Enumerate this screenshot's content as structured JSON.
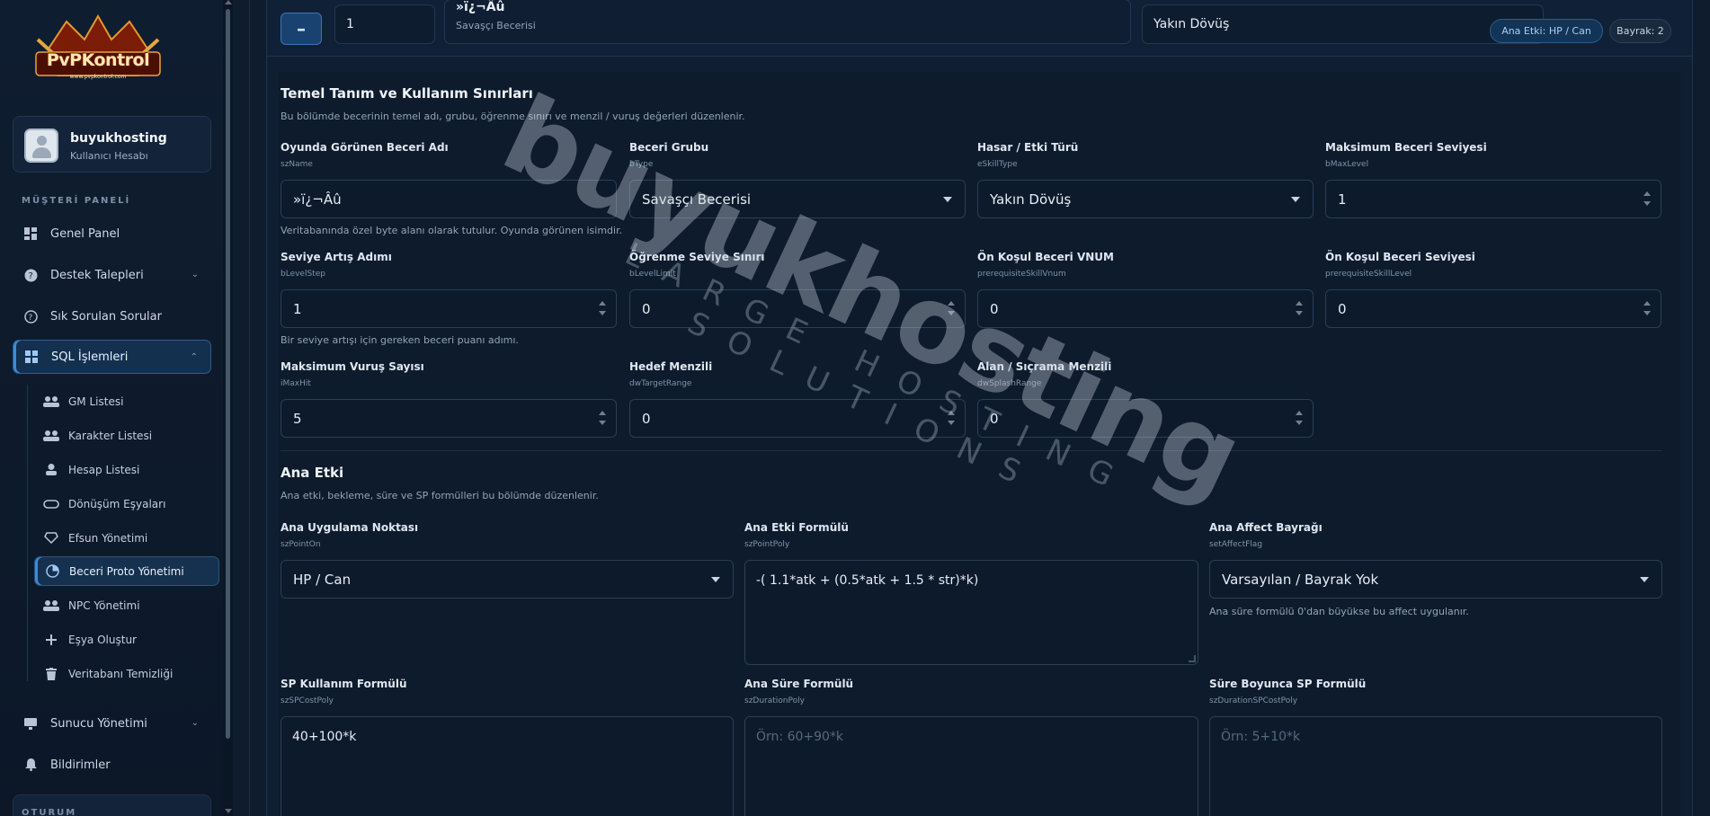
{
  "sidebar": {
    "logo": {
      "text": "PvPKontrol",
      "sub": "www.pvpkontrol.com"
    },
    "user": {
      "name": "buyukhosting",
      "role": "Kullanıcı Hesabı"
    },
    "section_customer": "MÜŞTERİ PANELİ",
    "section_session": "OTURUM",
    "items": [
      {
        "label": "Genel Panel",
        "icon": "dashboard-icon"
      },
      {
        "label": "Destek Talepleri",
        "icon": "help-circle-icon"
      },
      {
        "label": "Sık Sorulan Sorular",
        "icon": "question-icon"
      },
      {
        "label": "SQL İşlemleri",
        "icon": "grid-icon"
      },
      {
        "label": "Sunucu Yönetimi",
        "icon": "monitor-icon"
      },
      {
        "label": "Bildirimler",
        "icon": "bell-icon"
      }
    ],
    "sql_sub": [
      {
        "label": "GM Listesi",
        "icon": "users-icon"
      },
      {
        "label": "Karakter Listesi",
        "icon": "users-icon"
      },
      {
        "label": "Hesap Listesi",
        "icon": "user-icon"
      },
      {
        "label": "Dönüşüm Eşyaları",
        "icon": "ring-icon"
      },
      {
        "label": "Efsun Yönetimi",
        "icon": "gem-icon"
      },
      {
        "label": "Beceri Proto Yönetimi",
        "icon": "pie-icon"
      },
      {
        "label": "NPC Yönetimi",
        "icon": "users-icon"
      },
      {
        "label": "Eşya Oluştur",
        "icon": "plus-icon"
      },
      {
        "label": "Veritabanı Temizliği",
        "icon": "trash-icon"
      }
    ]
  },
  "header": {
    "minus_label": "–",
    "vnum_value": "1",
    "skill_title": "»ï¿¬Âû",
    "skill_group": "Savaşçı Becerisi",
    "skill_type": "Yakın Dövüş",
    "badge_effect": "Ana Etki: HP / Can",
    "badge_flag": "Bayrak: 2"
  },
  "basic": {
    "title": "Temel Tanım ve Kullanım Sınırları",
    "desc": "Bu bölümde becerinin temel adı, grubu, öğrenme sınırı ve menzil / vuruş değerleri düzenlenir.",
    "fields": {
      "name": {
        "label": "Oyunda Görünen Beceri Adı",
        "key": "szName",
        "value": "»ï¿¬Âû",
        "help": "Veritabanında özel byte alanı olarak tutulur. Oyunda görünen isimdir."
      },
      "group": {
        "label": "Beceri Grubu",
        "key": "bType",
        "value": "Savaşçı Becerisi"
      },
      "dmg": {
        "label": "Hasar / Etki Türü",
        "key": "eSkillType",
        "value": "Yakın Dövüş"
      },
      "maxlevel": {
        "label": "Maksimum Beceri Seviyesi",
        "key": "bMaxLevel",
        "value": "1"
      },
      "levelstep": {
        "label": "Seviye Artış Adımı",
        "key": "bLevelStep",
        "value": "1",
        "help": "Bir seviye artışı için gereken beceri puanı adımı."
      },
      "levellimit": {
        "label": "Öğrenme Seviye Sınırı",
        "key": "bLevelLimit",
        "value": "0"
      },
      "prereqvnum": {
        "label": "Ön Koşul Beceri VNUM",
        "key": "prerequisiteSkillVnum",
        "value": "0"
      },
      "prereqlevel": {
        "label": "Ön Koşul Beceri Seviyesi",
        "key": "prerequisiteSkillLevel",
        "value": "0"
      },
      "maxhit": {
        "label": "Maksimum Vuruş Sayısı",
        "key": "iMaxHit",
        "value": "5"
      },
      "range": {
        "label": "Hedef Menzili",
        "key": "dwTargetRange",
        "value": "0"
      },
      "splash": {
        "label": "Alan / Sıçrama Menzili",
        "key": "dwSplashRange",
        "value": "0"
      }
    }
  },
  "main_effect": {
    "title": "Ana Etki",
    "desc": "Ana etki, bekleme, süre ve SP formülleri bu bölümde düzenlenir.",
    "fields": {
      "pointon": {
        "label": "Ana Uygulama Noktası",
        "key": "szPointOn",
        "value": "HP / Can"
      },
      "pointpoly": {
        "label": "Ana Etki Formülü",
        "key": "szPointPoly",
        "value": "-( 1.1*atk + (0.5*atk +  1.5 * str)*k)"
      },
      "affectflag": {
        "label": "Ana Affect Bayrağı",
        "key": "setAffectFlag",
        "value": "Varsayılan / Bayrak Yok",
        "help": "Ana süre formülü 0'dan büyükse bu affect uygulanır."
      },
      "spcost": {
        "label": "SP Kullanım Formülü",
        "key": "szSPCostPoly",
        "value": "40+100*k"
      },
      "duration": {
        "label": "Ana Süre Formülü",
        "key": "szDurationPoly",
        "placeholder": "Örn: 60+90*k"
      },
      "durationsp": {
        "label": "Süre Boyunca SP Formülü",
        "key": "szDurationSPCostPoly",
        "placeholder": "Örn: 5+10*k"
      }
    }
  },
  "watermark": {
    "main": "buyukhosting",
    "sub": "LARGE HOSTING SOLUTIONS"
  },
  "colors": {
    "accent": "#3d8bd6",
    "bg": "#0d1a2b",
    "panel": "#0f1e32"
  }
}
